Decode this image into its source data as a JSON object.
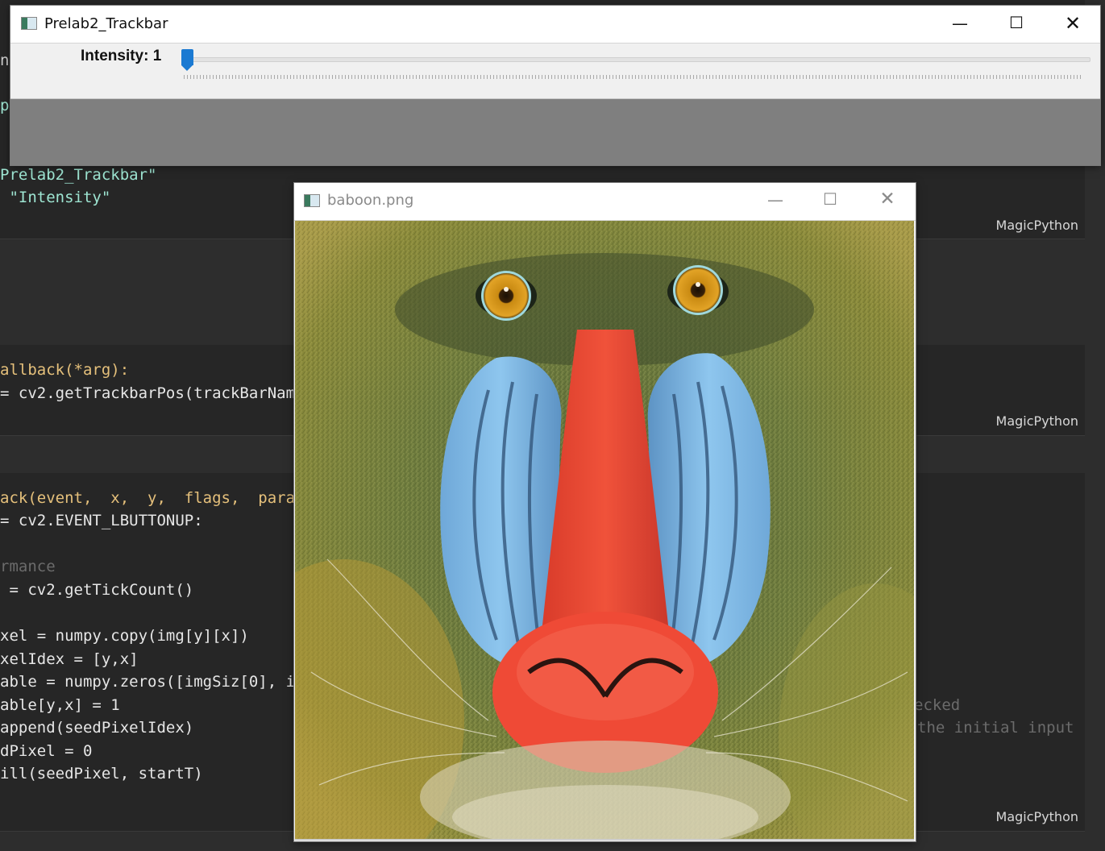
{
  "editor": {
    "cell_tag": "MagicPython",
    "cell1_lines": [
      "np",
      "pa",
      "Prelab2_Trackbar\"",
      " \"Intensity\""
    ],
    "cell2_lines": [
      "allback(*arg):",
      "= cv2.getTrackbarPos(trackBarNam"
    ],
    "cell3_lines": [
      "ack(event,  x,  y,  flags,  para",
      "= cv2.EVENT_LBUTTONUP:",
      "rmance",
      " = cv2.getTickCount()",
      "xel = numpy.copy(img[y][x])",
      "xelIdex = [y,x]",
      "able = numpy.zeros([imgSiz[0], i",
      "able[y,x] = 1",
      "append(seedPixelIdex)",
      "dPixel = 0",
      "ill(seedPixel, startT)"
    ],
    "right_comments": [
      "ecked",
      "the initial input"
    ]
  },
  "trackbar_window": {
    "title": "Prelab2_Trackbar",
    "trackbar_label": "Intensity: 1",
    "trackbar_value": 1
  },
  "image_window": {
    "title": "baboon.png"
  },
  "icons": [
    "window-app-icon",
    "minimize-icon",
    "maximize-icon",
    "close-icon"
  ]
}
